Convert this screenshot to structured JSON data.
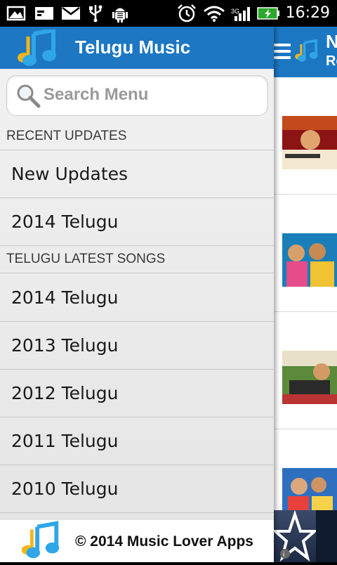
{
  "status_bar": {
    "time": "16:29",
    "icons": [
      "gallery-icon",
      "email-icon",
      "mail-icon",
      "usb-icon",
      "android-debug-icon",
      "alarm-icon",
      "wifi-icon",
      "signal-icon",
      "battery-charging-icon"
    ]
  },
  "drawer": {
    "title": "Telugu Music",
    "search": {
      "placeholder": "Search Menu"
    },
    "sections": [
      {
        "header": "RECENT UPDATES",
        "items": [
          "New Updates",
          "2014 Telugu"
        ]
      },
      {
        "header": "TELUGU LATEST SONGS",
        "items": [
          "2014 Telugu",
          "2013 Telugu",
          "2012 Telugu",
          "2011 Telugu",
          "2010 Telugu"
        ]
      }
    ],
    "footer_text": "© 2014 Music Lover Apps"
  },
  "content": {
    "title_partial": "N",
    "subtitle_partial": "Re",
    "album_count": 4
  },
  "colors": {
    "brand_blue": "#1d77c2",
    "drawer_bg": "#ececec",
    "note_blue": "#2fa6e6",
    "note_yellow": "#f3b51b"
  }
}
